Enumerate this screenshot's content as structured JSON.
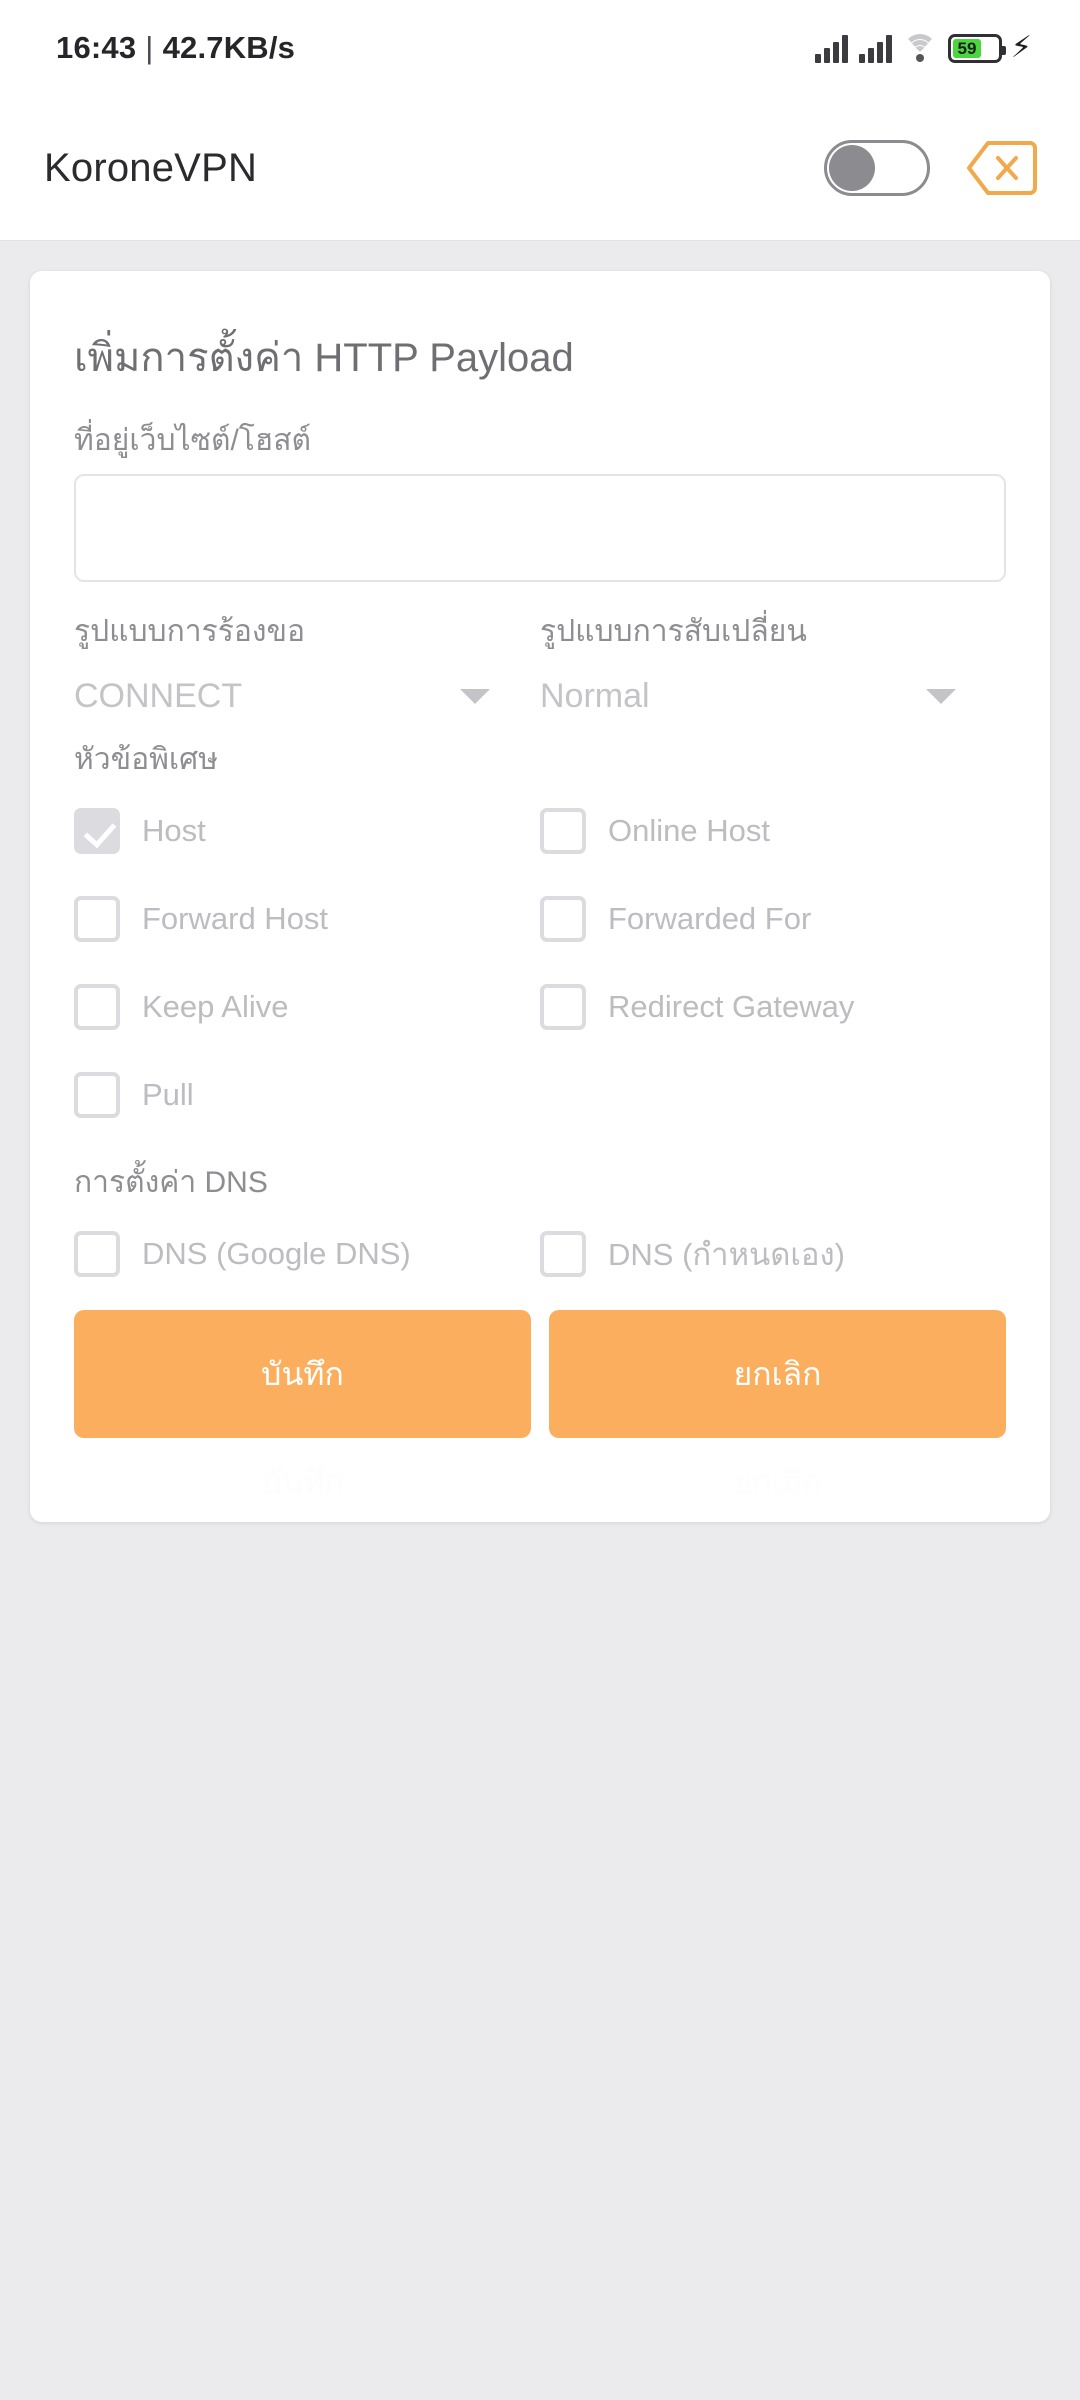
{
  "statusbar": {
    "time": "16:43",
    "separator": "|",
    "network_speed": "42.7KB/s",
    "battery_percent": "59",
    "charging_glyph": "⚡",
    "icons": [
      "signal-icon",
      "signal-icon",
      "wifi-icon",
      "battery-icon",
      "charging-bolt-icon"
    ]
  },
  "appbar": {
    "title": "KoroneVPN",
    "toggle_state": "off",
    "close_icon": "close-x-icon",
    "accent_color": "#f2a94c"
  },
  "card": {
    "title": "เพิ่มการตั้งค่า HTTP Payload",
    "host": {
      "label": "ที่อยู่เว็บไซต์/โฮสต์",
      "value": "",
      "placeholder": ""
    },
    "request_method": {
      "label": "รูปแบบการร้องขอ",
      "value": "CONNECT"
    },
    "switch_method": {
      "label": "รูปแบบการสับเปลี่ยน",
      "value": "Normal"
    },
    "special_headers": {
      "label": "หัวข้อพิเศษ",
      "items": [
        {
          "label": "Host",
          "checked": true
        },
        {
          "label": "Online Host",
          "checked": false
        },
        {
          "label": "Forward Host",
          "checked": false
        },
        {
          "label": "Forwarded For",
          "checked": false
        },
        {
          "label": "Keep Alive",
          "checked": false
        },
        {
          "label": "Redirect Gateway",
          "checked": false
        },
        {
          "label": "Pull",
          "checked": false
        }
      ]
    },
    "dns_settings": {
      "label": "การตั้งค่า DNS",
      "items": [
        {
          "label": "DNS (Google DNS)",
          "checked": false
        },
        {
          "label": "DNS (กำหนดเอง)",
          "checked": false
        }
      ]
    },
    "buttons": {
      "save_label": "บันทึก",
      "cancel_label": "ยกเลิก",
      "button_color": "#fbae5e"
    }
  },
  "colors": {
    "page_background": "#ebebed",
    "card_background": "#ffffff",
    "accent": "#fbae5e",
    "muted_text": "#bcbcc1",
    "label_text": "#8d8d92"
  }
}
